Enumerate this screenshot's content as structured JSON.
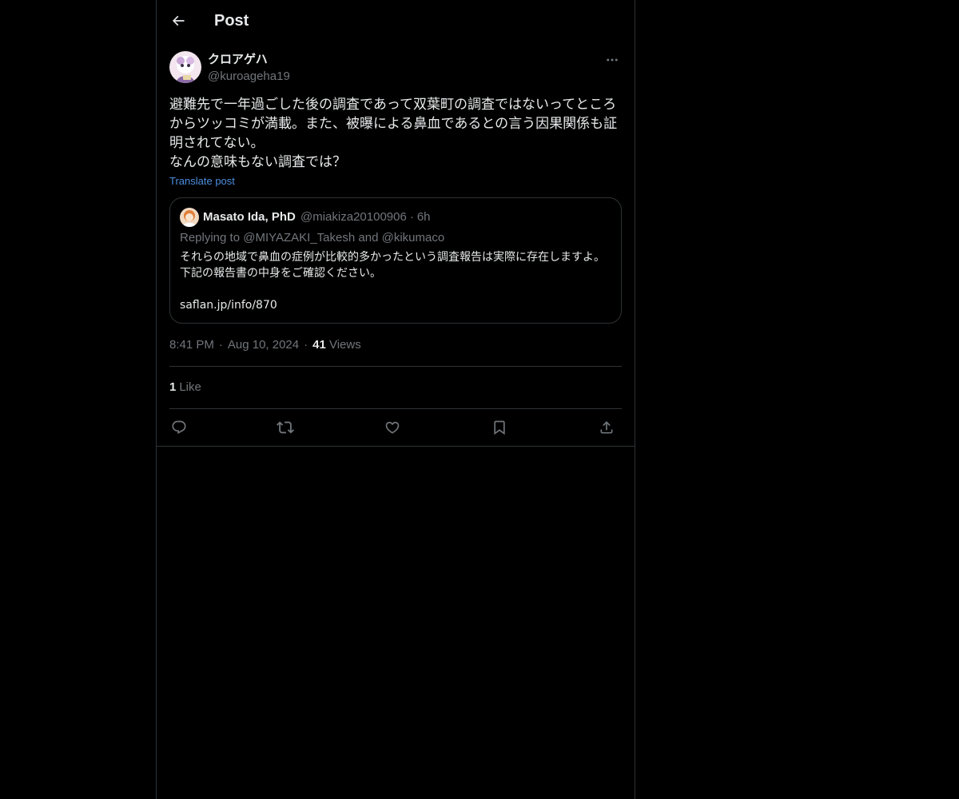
{
  "header": {
    "title": "Post"
  },
  "post": {
    "display_name": "クロアゲハ",
    "handle": "@kuroageha19",
    "text": "避難先で一年過ごした後の調査であって双葉町の調査ではないってところからツッコミが満載。また、被曝による鼻血であるとの言う因果関係も証明されてない。\nなんの意味もない調査では？",
    "translate_label": "Translate post",
    "time": "8:41 PM",
    "date": "Aug 10, 2024",
    "views_count": "41",
    "views_label": "Views",
    "likes_count": "1",
    "likes_label": "Like"
  },
  "quote": {
    "display_name": "Masato Ida, PhD",
    "handle": "@miakiza20100906",
    "age": "6h",
    "replying_prefix": "Replying to",
    "replying_mention_1": "@MIYAZAKI_Takesh",
    "replying_and": "and",
    "replying_mention_2": "@kikumaco",
    "text": "それらの地域で鼻血の症例が比較的多かったという調査報告は実際に存在しますよ。下記の報告書の中身をご確認ください。\n\nsaflan.jp/info/870"
  },
  "icons": {
    "back": "arrow-left-icon",
    "more": "more-horizontal-icon",
    "reply": "reply-icon",
    "repost": "repost-icon",
    "like": "heart-icon",
    "bookmark": "bookmark-icon",
    "share": "share-icon"
  },
  "colors": {
    "background": "#000000",
    "text": "#e7e9ea",
    "secondary": "#71767b",
    "link": "#4c8fe0",
    "border": "#2f3336"
  }
}
